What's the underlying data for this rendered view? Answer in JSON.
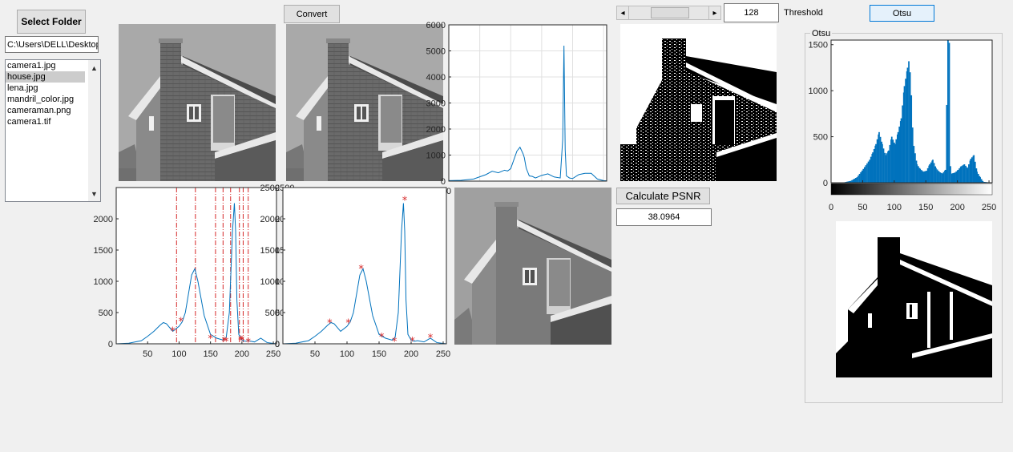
{
  "toolbar": {
    "select_folder_label": "Select Folder",
    "folder_path": "C:\\Users\\DELL\\Desktop\\",
    "convert_label": "Convert",
    "threshold_value": "128",
    "threshold_label": "Threshold",
    "otsu_label": "Otsu",
    "slider_position": 0.5
  },
  "file_list": {
    "items": [
      "camera1.jpg",
      "house.jpg",
      "lena.jpg",
      "mandril_color.jpg",
      "cameraman.png",
      "camera1.tif"
    ],
    "selected_index": 1
  },
  "psnr": {
    "button_label": "Calculate PSNR",
    "value": "38.0964"
  },
  "otsu_panel": {
    "title": "Otsu"
  },
  "icons": {
    "slider_left": "◂",
    "slider_right": "▸",
    "scroll_up": "▲",
    "scroll_down": "▼"
  },
  "colors": {
    "hist_line": "#0072bd",
    "hist_bar": "#0072bd",
    "marker": "#d62728",
    "vline": "#d62728",
    "grid": "#e0e0e0"
  },
  "chart_data": [
    {
      "id": "histogram_top",
      "type": "line",
      "xlim": [
        0,
        255
      ],
      "ylim": [
        0,
        6000
      ],
      "yticks": [
        0,
        1000,
        2000,
        3000,
        4000,
        5000,
        6000
      ],
      "xticks": [
        0
      ],
      "grid": true,
      "series": [
        {
          "x": [
            0,
            20,
            40,
            60,
            70,
            80,
            90,
            95,
            100,
            110,
            115,
            120,
            122,
            125,
            130,
            135,
            140,
            150,
            160,
            170,
            180,
            184,
            186,
            188,
            190,
            195,
            200,
            210,
            220,
            230,
            240,
            250,
            255
          ],
          "y": [
            20,
            30,
            80,
            250,
            380,
            320,
            420,
            390,
            480,
            1150,
            1300,
            1050,
            900,
            500,
            200,
            180,
            120,
            220,
            280,
            160,
            120,
            1600,
            5200,
            1200,
            200,
            120,
            100,
            250,
            300,
            300,
            80,
            20,
            10
          ]
        }
      ]
    },
    {
      "id": "histogram_bottom_left",
      "type": "line",
      "xlim": [
        0,
        255
      ],
      "ylim": [
        0,
        2500
      ],
      "yticks": [
        0,
        500,
        1000,
        1500,
        2000
      ],
      "xticks": [
        50,
        100,
        150,
        200,
        250
      ],
      "y2ticks": [
        0,
        500,
        1000,
        1500,
        2000,
        2500
      ],
      "grid": false,
      "series": [
        {
          "x": [
            0,
            20,
            40,
            50,
            60,
            70,
            75,
            80,
            90,
            100,
            105,
            110,
            115,
            120,
            125,
            130,
            140,
            150,
            160,
            170,
            175,
            180,
            185,
            188,
            190,
            192,
            195,
            200,
            205,
            210,
            220,
            225,
            230,
            240,
            255
          ],
          "y": [
            0,
            10,
            50,
            120,
            200,
            300,
            340,
            320,
            200,
            280,
            350,
            500,
            800,
            1100,
            1200,
            1000,
            450,
            150,
            90,
            60,
            100,
            500,
            1800,
            2250,
            1800,
            700,
            150,
            60,
            40,
            50,
            30,
            60,
            90,
            20,
            0
          ]
        }
      ],
      "markers": {
        "x": [
          90,
          103,
          150,
          172,
          175,
          198,
          200,
          210
        ],
        "y": [
          200,
          350,
          80,
          40,
          35,
          55,
          50,
          20
        ]
      },
      "vlines": [
        96,
        126,
        158,
        170,
        182,
        196,
        202,
        210
      ]
    },
    {
      "id": "histogram_bottom_right",
      "type": "line",
      "xlim": [
        0,
        255
      ],
      "ylim": [
        0,
        2500
      ],
      "yticks": [
        0,
        500,
        1000,
        1500,
        2000,
        2500
      ],
      "xticks": [
        50,
        100,
        150,
        200,
        250
      ],
      "grid": false,
      "series": [
        {
          "x": [
            0,
            20,
            40,
            50,
            60,
            70,
            75,
            80,
            90,
            100,
            105,
            110,
            115,
            120,
            125,
            130,
            140,
            150,
            160,
            170,
            175,
            180,
            185,
            188,
            190,
            192,
            195,
            200,
            205,
            210,
            220,
            225,
            230,
            240,
            255
          ],
          "y": [
            0,
            10,
            50,
            120,
            200,
            300,
            340,
            320,
            200,
            280,
            350,
            500,
            800,
            1100,
            1200,
            1000,
            450,
            150,
            90,
            60,
            100,
            500,
            1800,
            2250,
            1800,
            700,
            150,
            60,
            40,
            50,
            30,
            60,
            90,
            20,
            0
          ]
        }
      ],
      "markers": {
        "x": [
          73,
          102,
          122,
          154,
          174,
          190,
          202,
          230
        ],
        "y": [
          330,
          330,
          1190,
          100,
          30,
          2290,
          40,
          90
        ]
      }
    },
    {
      "id": "otsu_histogram",
      "type": "bar",
      "xlim": [
        0,
        255
      ],
      "ylim": [
        0,
        1550
      ],
      "yticks": [
        0,
        500,
        1000,
        1500
      ],
      "xticks": [
        0,
        50,
        100,
        150,
        200,
        250
      ],
      "grid": false,
      "colorbar": true,
      "series": [
        {
          "x": [
            0,
            20,
            30,
            40,
            50,
            60,
            65,
            70,
            75,
            80,
            85,
            90,
            95,
            100,
            105,
            110,
            115,
            120,
            122,
            124,
            126,
            128,
            130,
            135,
            140,
            145,
            150,
            155,
            160,
            165,
            170,
            175,
            180,
            184,
            186,
            188,
            190,
            195,
            200,
            205,
            210,
            215,
            220,
            225,
            230,
            235,
            240,
            255
          ],
          "y": [
            0,
            5,
            20,
            60,
            150,
            250,
            330,
            420,
            550,
            420,
            300,
            350,
            500,
            420,
            550,
            700,
            1050,
            1250,
            1320,
            1200,
            950,
            600,
            400,
            200,
            150,
            120,
            130,
            200,
            250,
            160,
            120,
            100,
            140,
            1550,
            1520,
            180,
            100,
            110,
            140,
            180,
            200,
            160,
            260,
            300,
            120,
            60,
            10,
            0
          ]
        }
      ]
    }
  ]
}
